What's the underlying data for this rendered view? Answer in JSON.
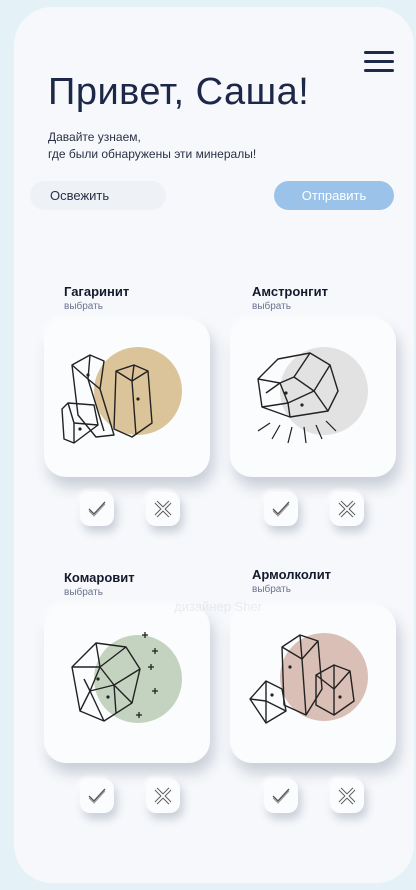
{
  "header": {
    "title": "Привет, Саша!",
    "subtitle_line1": "Давайте узнаем,",
    "subtitle_line2": "где были обнаружены эти минералы!",
    "menu_icon": "hamburger-menu-icon"
  },
  "actions": {
    "refresh_label": "Освежить",
    "send_label": "Отправить"
  },
  "minerals": [
    {
      "name": "Гагаринит",
      "link": "выбрать",
      "circle_color": "#dcc49a"
    },
    {
      "name": "Амстронгит",
      "link": "выбрать",
      "circle_color": "#e2e2e2"
    },
    {
      "name": "Комаровит",
      "link": "выбрать",
      "circle_color": "#c4d3c0"
    },
    {
      "name": "Армолколит",
      "link": "выбрать",
      "circle_color": "#d9bfb6"
    }
  ],
  "card_actions": {
    "confirm_icon": "check-icon",
    "reject_icon": "x-icon"
  },
  "colors": {
    "background": "#e4f2f8",
    "panel": "#f6f8fb",
    "send_button": "#9bc3ea",
    "text_dark": "#1d2748"
  },
  "watermark_text": "дизайнер Sher"
}
